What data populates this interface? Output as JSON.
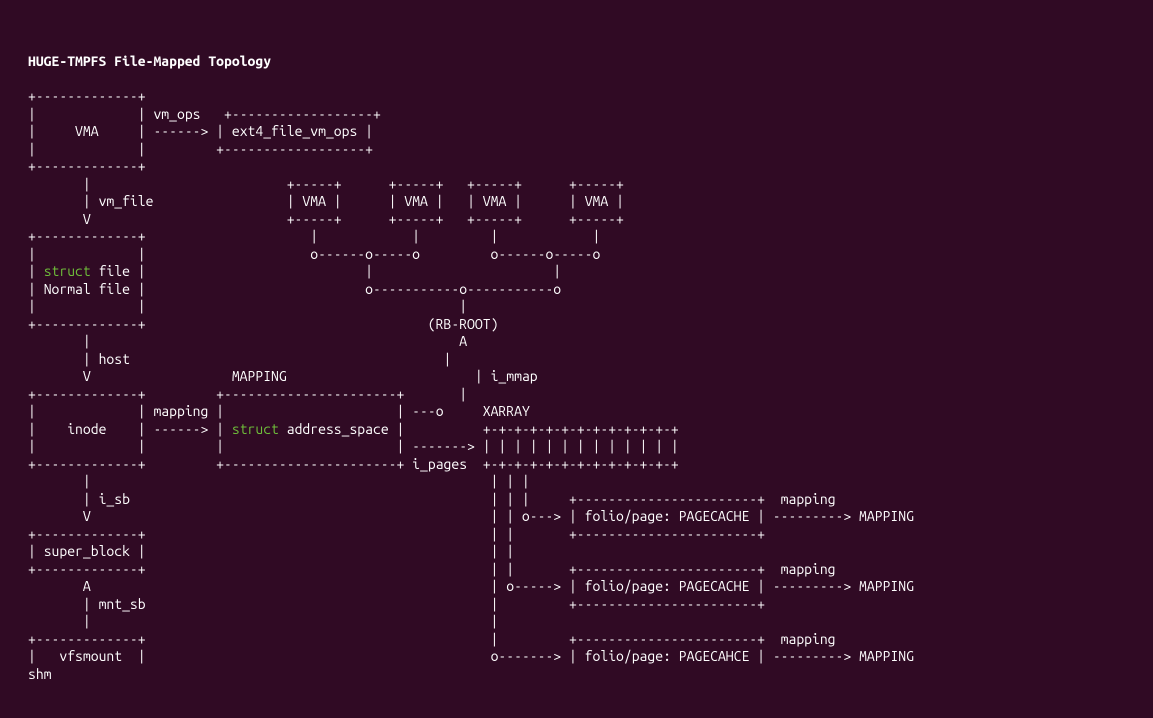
{
  "title": "HUGE-TMPFS File-Mapped Topology",
  "keywords": {
    "struct": "struct"
  },
  "labels": {
    "vm_ops": "vm_ops",
    "VMA": "VMA",
    "ext4_file_vm_ops": "ext4_file_vm_ops",
    "vm_file": "vm_file",
    "file_line": " file |",
    "Normal_file": "Normal file",
    "RB_ROOT": "(RB-ROOT)",
    "host": "host",
    "MAPPING": "MAPPING",
    "i_mmap": "i_mmap",
    "mapping_hdr": "mapping",
    "inode": "inode",
    "address_space": " address_space |",
    "XARRAY": "XARRAY",
    "i_pages": "i_pages",
    "i_sb": "i_sb",
    "folio_PAGECACHE": "folio/page: PAGECACHE",
    "folio_PAGECAHCE": "folio/page: PAGECAHCE",
    "MAPPING_UP": "MAPPING",
    "super_block": "super_block",
    "mnt_sb": "mnt_sb",
    "vfsmount": "vfsmount",
    "shm": "shm"
  }
}
